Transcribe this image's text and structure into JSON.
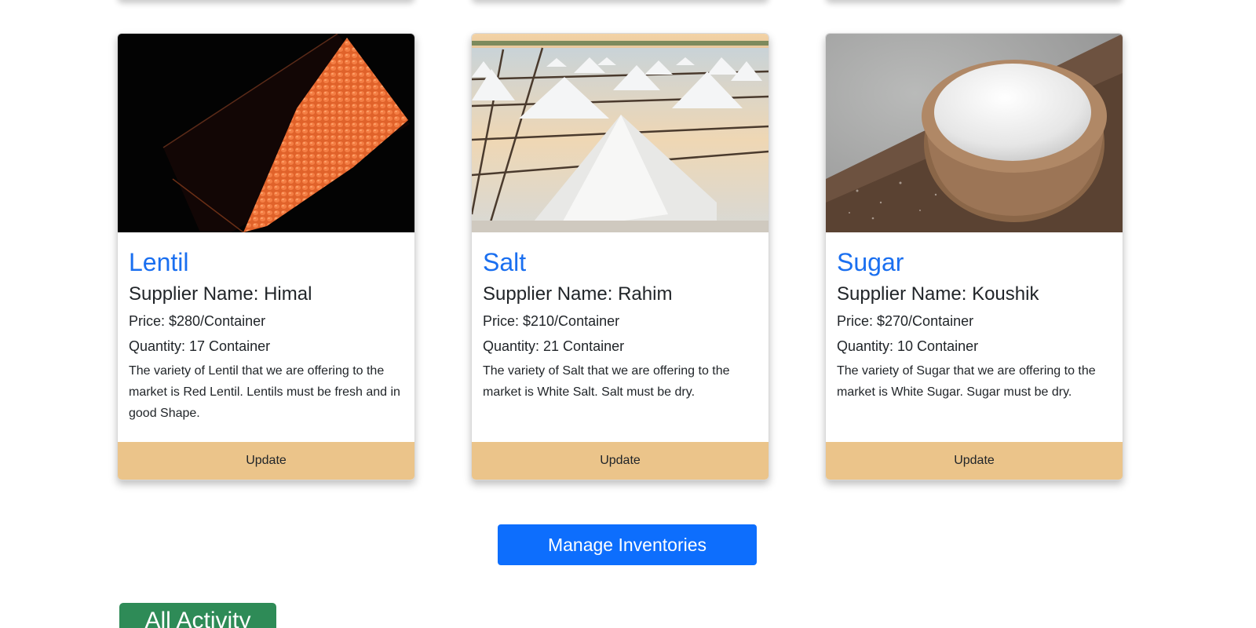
{
  "products": [
    {
      "name": "Lentil",
      "supplier": "Supplier Name: Himal",
      "price": "Price: $280/Container",
      "quantity": "Quantity: 17 Container",
      "description": "The variety of Lentil that we are offering to the market is Red Lentil. Lentils must be fresh and in good Shape.",
      "image": "red-lentils-photo",
      "update_label": "Update"
    },
    {
      "name": "Salt",
      "supplier": "Supplier Name: Rahim",
      "price": "Price: $210/Container",
      "quantity": "Quantity: 21 Container",
      "description": "The variety of Salt that we are offering to the market is White Salt. Salt must be dry.",
      "image": "salt-flats-photo",
      "update_label": "Update"
    },
    {
      "name": "Sugar",
      "supplier": "Supplier Name: Koushik",
      "price": "Price: $270/Container",
      "quantity": "Quantity: 10 Container",
      "description": "The variety of Sugar that we are offering to the market is White Sugar. Sugar must be dry.",
      "image": "sugar-bowl-photo",
      "update_label": "Update"
    }
  ],
  "manage_button_label": "Manage Inventories",
  "activity_heading": "All Activity",
  "colors": {
    "title_blue": "#1a6ff0",
    "update_footer": "#ebc48a",
    "primary_button": "#0d6efd",
    "activity_green": "#2e8b57"
  }
}
